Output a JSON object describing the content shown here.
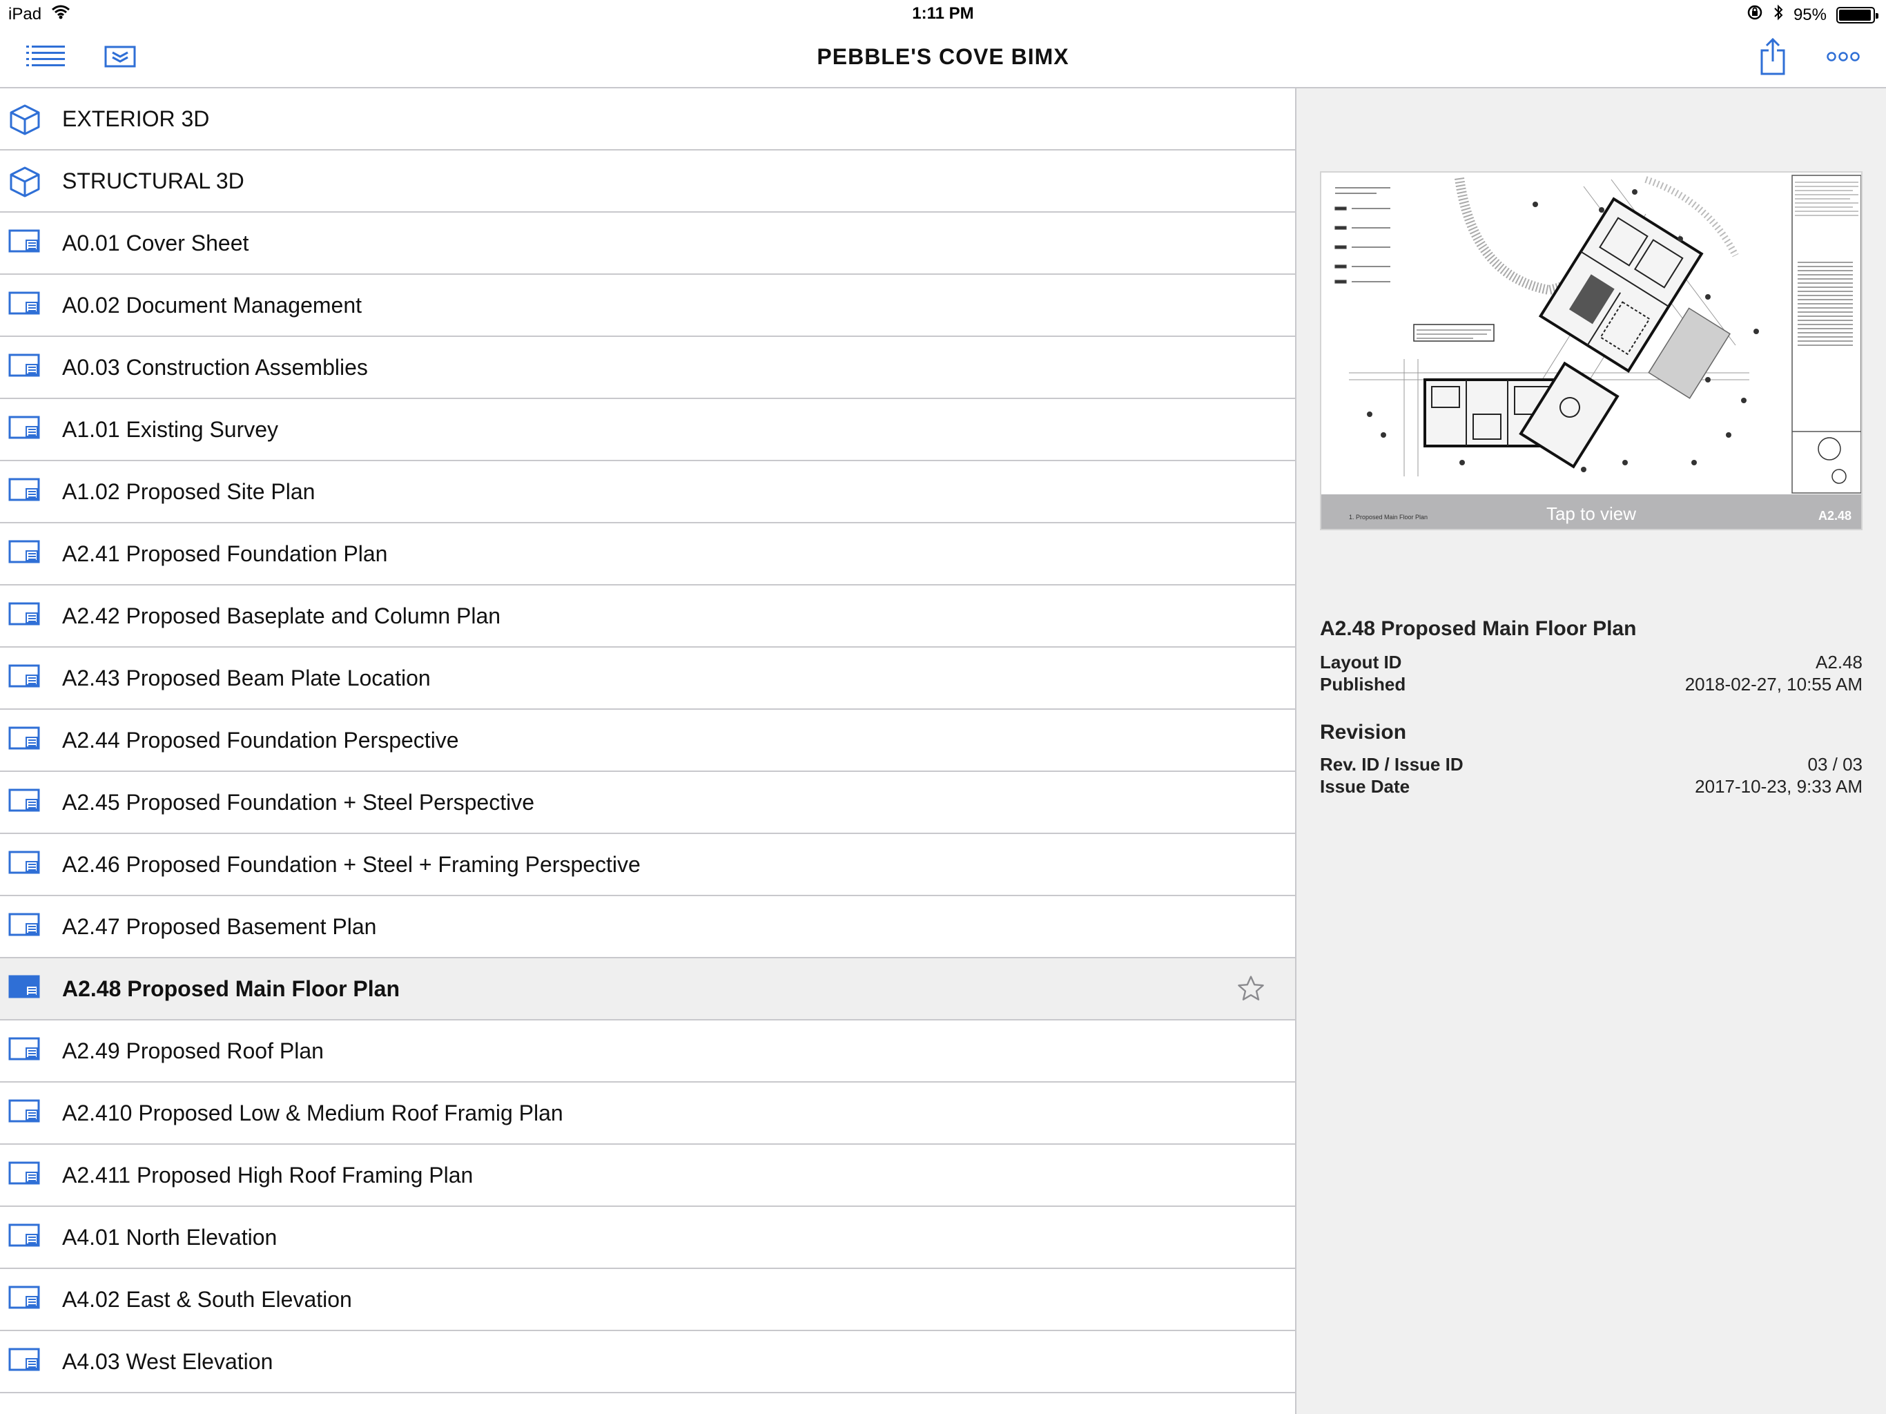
{
  "status": {
    "device": "iPad",
    "time": "1:11 PM",
    "battery_percent": "95%",
    "battery_level": 0.95
  },
  "nav": {
    "title": "PEBBLE'S COVE BIMX"
  },
  "list": {
    "items": [
      {
        "label": "EXTERIOR 3D",
        "type": "3d"
      },
      {
        "label": "STRUCTURAL 3D",
        "type": "3d"
      },
      {
        "label": "A0.01 Cover Sheet",
        "type": "layout"
      },
      {
        "label": "A0.02 Document Management",
        "type": "layout"
      },
      {
        "label": "A0.03 Construction Assemblies",
        "type": "layout"
      },
      {
        "label": "A1.01 Existing Survey",
        "type": "layout"
      },
      {
        "label": "A1.02 Proposed Site Plan",
        "type": "layout"
      },
      {
        "label": "A2.41 Proposed Foundation Plan",
        "type": "layout"
      },
      {
        "label": "A2.42 Proposed Baseplate and Column Plan",
        "type": "layout"
      },
      {
        "label": "A2.43 Proposed Beam Plate Location",
        "type": "layout"
      },
      {
        "label": "A2.44 Proposed Foundation Perspective",
        "type": "layout"
      },
      {
        "label": "A2.45 Proposed Foundation + Steel Perspective",
        "type": "layout"
      },
      {
        "label": "A2.46 Proposed Foundation + Steel + Framing Perspective",
        "type": "layout"
      },
      {
        "label": "A2.47 Proposed Basement Plan",
        "type": "layout"
      },
      {
        "label": "A2.48 Proposed Main Floor Plan",
        "type": "layout",
        "selected": true
      },
      {
        "label": "A2.49 Proposed Roof Plan",
        "type": "layout"
      },
      {
        "label": "A2.410 Proposed Low & Medium Roof Framig Plan",
        "type": "layout"
      },
      {
        "label": "A2.411 Proposed High Roof Framing Plan",
        "type": "layout"
      },
      {
        "label": "A4.01 North Elevation",
        "type": "layout"
      },
      {
        "label": "A4.02 East & South Elevation",
        "type": "layout"
      },
      {
        "label": "A4.03 West Elevation",
        "type": "layout"
      }
    ]
  },
  "detail": {
    "thumbnail_caption": "Tap to view",
    "thumbnail_sheet_id": "A2.48",
    "thumbnail_sheet_label": "1. Proposed Main Floor Plan",
    "title": "A2.48 Proposed Main Floor Plan",
    "layout_id_label": "Layout ID",
    "layout_id_value": "A2.48",
    "published_label": "Published",
    "published_value": "2018-02-27, 10:55 AM",
    "revision_heading": "Revision",
    "rev_id_label": "Rev. ID / Issue ID",
    "rev_id_value": "03 / 03",
    "issue_date_label": "Issue Date",
    "issue_date_value": "2017-10-23, 9:33 AM"
  },
  "colors": {
    "accent": "#2f6fd6",
    "separator": "#c8c8cc",
    "detail_bg": "#f0f0f0",
    "selected_row_bg": "#efefef"
  },
  "icons": {
    "menu": "list-icon",
    "layers": "folder-layers-icon",
    "share": "share-icon",
    "more": "more-icon",
    "model": "cube-icon",
    "layout": "sheet-icon",
    "favorite": "star-icon"
  }
}
